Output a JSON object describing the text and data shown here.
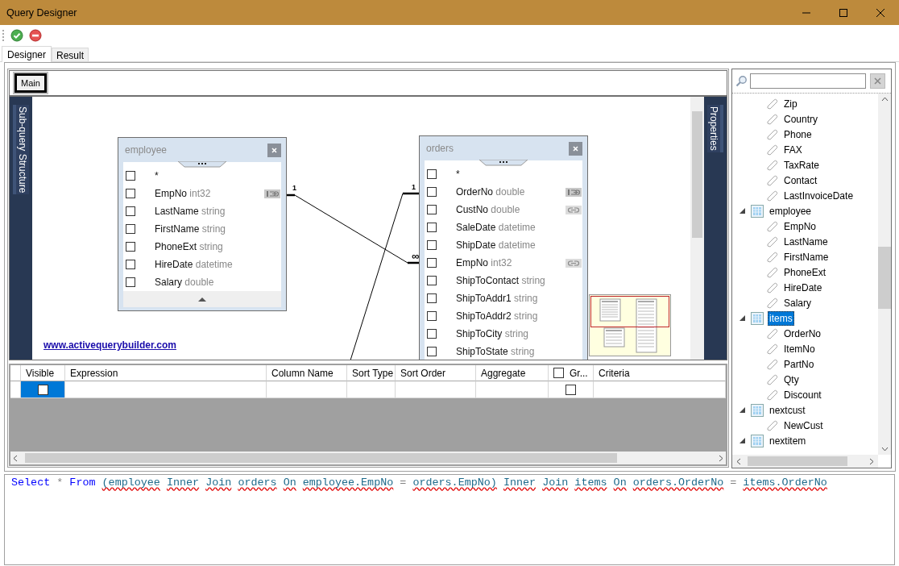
{
  "window": {
    "title": "Query Designer"
  },
  "tabs": [
    {
      "label": "Designer",
      "selected": true
    },
    {
      "label": "Result",
      "selected": false
    }
  ],
  "designer": {
    "subquery_tabs": [
      {
        "label": "Main",
        "selected": true
      }
    ],
    "left_panel": {
      "label": "Sub-query Structure"
    },
    "right_panel": {
      "label": "Properties"
    },
    "tables": [
      {
        "name": "employee",
        "fields": [
          {
            "name": "*",
            "checked": false,
            "primary_key": false,
            "linked": false
          },
          {
            "name": "EmpNo",
            "type": "int32",
            "checked": false,
            "primary_key": true,
            "linked": false
          },
          {
            "name": "LastName",
            "type": "string",
            "checked": false,
            "primary_key": false,
            "linked": false
          },
          {
            "name": "FirstName",
            "type": "string",
            "checked": false,
            "primary_key": false,
            "linked": false
          },
          {
            "name": "PhoneExt",
            "type": "string",
            "checked": false,
            "primary_key": false,
            "linked": false
          },
          {
            "name": "HireDate",
            "type": "datetime",
            "checked": false,
            "primary_key": false,
            "linked": false
          },
          {
            "name": "Salary",
            "type": "double",
            "checked": false,
            "primary_key": false,
            "linked": false
          }
        ]
      },
      {
        "name": "orders",
        "fields": [
          {
            "name": "*",
            "checked": false,
            "primary_key": false,
            "linked": false
          },
          {
            "name": "OrderNo",
            "type": "double",
            "checked": false,
            "primary_key": true,
            "linked": false
          },
          {
            "name": "CustNo",
            "type": "double",
            "checked": false,
            "primary_key": false,
            "linked": true
          },
          {
            "name": "SaleDate",
            "type": "datetime",
            "checked": false,
            "primary_key": false,
            "linked": false
          },
          {
            "name": "ShipDate",
            "type": "datetime",
            "checked": false,
            "primary_key": false,
            "linked": false
          },
          {
            "name": "EmpNo",
            "type": "int32",
            "checked": false,
            "primary_key": false,
            "linked": true
          },
          {
            "name": "ShipToContact",
            "type": "string",
            "checked": false,
            "primary_key": false,
            "linked": false
          },
          {
            "name": "ShipToAddr1",
            "type": "string",
            "checked": false,
            "primary_key": false,
            "linked": false
          },
          {
            "name": "ShipToAddr2",
            "type": "string",
            "checked": false,
            "primary_key": false,
            "linked": false
          },
          {
            "name": "ShipToCity",
            "type": "string",
            "checked": false,
            "primary_key": false,
            "linked": false
          },
          {
            "name": "ShipToState",
            "type": "string",
            "checked": false,
            "primary_key": false,
            "linked": false
          }
        ]
      }
    ],
    "links": [
      {
        "to_label": "1"
      },
      {
        "from_label": "1",
        "to_label": "∞"
      }
    ],
    "website_link": "www.activequerybuilder.com"
  },
  "grid": {
    "columns": [
      {
        "label": "Visible",
        "kind": "text"
      },
      {
        "label": "Expression",
        "kind": "text"
      },
      {
        "label": "Column Name",
        "kind": "text"
      },
      {
        "label": "Sort Type",
        "kind": "text"
      },
      {
        "label": "Sort Order",
        "kind": "text"
      },
      {
        "label": "Aggregate",
        "kind": "text"
      },
      {
        "label": "Gr...",
        "kind": "checkbox",
        "checked": false
      },
      {
        "label": "Criteria",
        "kind": "text"
      }
    ],
    "rows": [
      {
        "visible": false,
        "grouped": false,
        "selected": true
      }
    ]
  },
  "tree": {
    "items": [
      {
        "kind": "field",
        "label": "Zip"
      },
      {
        "kind": "field",
        "label": "Country"
      },
      {
        "kind": "field",
        "label": "Phone"
      },
      {
        "kind": "field",
        "label": "FAX"
      },
      {
        "kind": "field",
        "label": "TaxRate"
      },
      {
        "kind": "field",
        "label": "Contact"
      },
      {
        "kind": "field",
        "label": "LastInvoiceDate"
      },
      {
        "kind": "table",
        "label": "employee",
        "expanded": true,
        "selected": false,
        "children": [
          {
            "kind": "field",
            "label": "EmpNo"
          },
          {
            "kind": "field",
            "label": "LastName"
          },
          {
            "kind": "field",
            "label": "FirstName"
          },
          {
            "kind": "field",
            "label": "PhoneExt"
          },
          {
            "kind": "field",
            "label": "HireDate"
          },
          {
            "kind": "field",
            "label": "Salary"
          }
        ]
      },
      {
        "kind": "table",
        "label": "items",
        "expanded": true,
        "selected": true,
        "children": [
          {
            "kind": "field",
            "label": "OrderNo"
          },
          {
            "kind": "field",
            "label": "ItemNo"
          },
          {
            "kind": "field",
            "label": "PartNo"
          },
          {
            "kind": "field",
            "label": "Qty"
          },
          {
            "kind": "field",
            "label": "Discount"
          }
        ]
      },
      {
        "kind": "table",
        "label": "nextcust",
        "expanded": true,
        "selected": false,
        "children": [
          {
            "kind": "field",
            "label": "NewCust"
          }
        ]
      },
      {
        "kind": "table",
        "label": "nextitem",
        "expanded": true,
        "selected": false
      }
    ]
  },
  "sql": {
    "tokens": [
      {
        "text": "Select",
        "kind": "keyword"
      },
      {
        "text": "*",
        "kind": "operator"
      },
      {
        "text": "From",
        "kind": "keyword"
      },
      {
        "text": "(employee",
        "kind": "name"
      },
      {
        "text": "Inner",
        "kind": "name"
      },
      {
        "text": "Join",
        "kind": "name"
      },
      {
        "text": "orders",
        "kind": "name"
      },
      {
        "text": "On",
        "kind": "name"
      },
      {
        "text": "employee.EmpNo",
        "kind": "name"
      },
      {
        "text": "=",
        "kind": "operator"
      },
      {
        "text": "orders.EmpNo)",
        "kind": "name"
      },
      {
        "text": "Inner",
        "kind": "name"
      },
      {
        "text": "Join",
        "kind": "name"
      },
      {
        "text": "items",
        "kind": "name"
      },
      {
        "text": "On",
        "kind": "name"
      },
      {
        "text": "orders.OrderNo",
        "kind": "name"
      },
      {
        "text": "=",
        "kind": "operator"
      },
      {
        "text": "items.OrderNo",
        "kind": "name"
      }
    ]
  }
}
